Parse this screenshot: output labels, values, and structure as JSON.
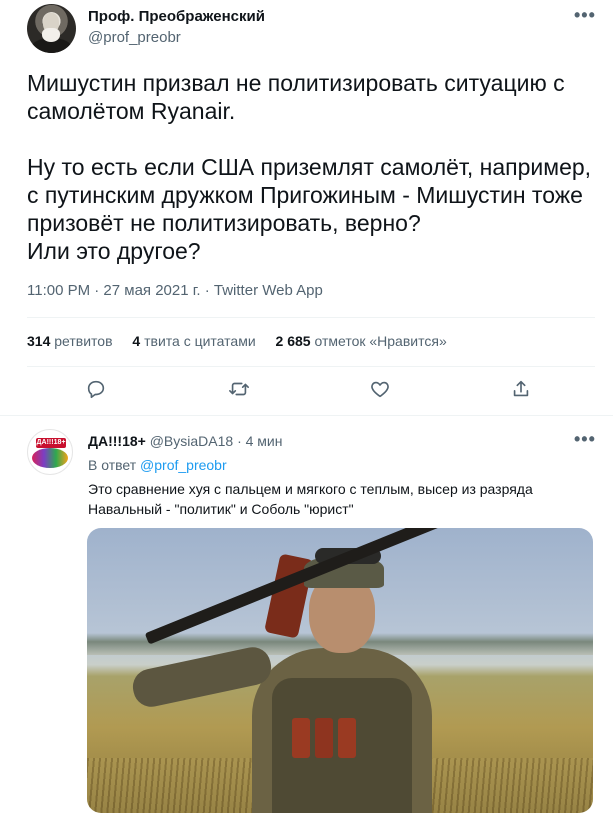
{
  "main_tweet": {
    "display_name": "Проф. Преображенский",
    "handle": "@prof_preobr",
    "more": "•••",
    "text": "Мишустин призвал не политизировать ситуацию с самолётом Ryanair.\n\nНу то есть если США приземлят самолёт, например, с путинским дружком Пригожиным - Мишустин тоже призовёт не политизировать, верно?\nИли это другое?",
    "meta": "11:00 PM · 27 мая 2021 г. · Twitter Web App",
    "stats": {
      "retweets_count": "314",
      "retweets_label": "ретвитов",
      "quotes_count": "4",
      "quotes_label": "твита с цитатами",
      "likes_count": "2 685",
      "likes_label": "отметок «Нравится»"
    },
    "actions": [
      "reply-icon",
      "retweet-icon",
      "like-icon",
      "share-icon"
    ]
  },
  "reply_tweet": {
    "display_name": "ДА!!!18+",
    "handle": "@BysiaDA18",
    "time": "· 4 мин",
    "more": "•••",
    "reply_to_prefix": "В ответ",
    "reply_to_handle": "@prof_preobr",
    "text": "Это сравнение хуя  с пальцем  и мягкого с теплым, высер из разряда Навальный - \"политик\" и Соболь \"юрист\"",
    "avatar_text": "ДА!!!18+"
  },
  "colors": {
    "text_primary": "#0f1419",
    "text_secondary": "#536471",
    "link": "#1d9bf0",
    "divider": "#eff3f4"
  }
}
